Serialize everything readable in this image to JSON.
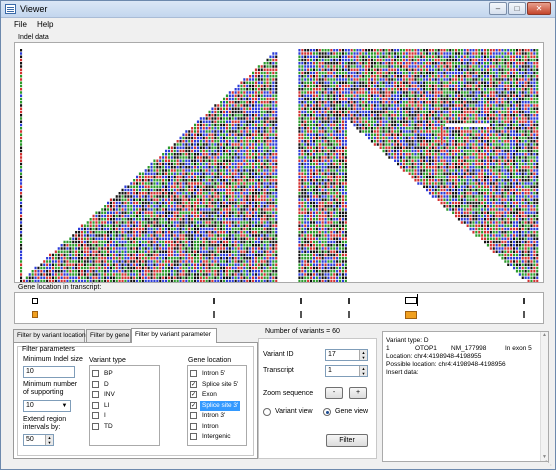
{
  "window": {
    "title": "Viewer",
    "minimize_icon": "minimize-icon",
    "maximize_icon": "maximize-icon",
    "close_icon": "close-icon"
  },
  "menu": [
    "File",
    "Help"
  ],
  "indel_section": {
    "label": "Indel data",
    "bases": "ACGT",
    "colors": {
      "A": "#2a9a2a",
      "C": "#2a3ad8",
      "G": "#111111",
      "T": "#d23030"
    }
  },
  "gene_location_section": {
    "label": "Gene location in transcript:"
  },
  "tabs": [
    "Filter by variant location",
    "Filter by gene",
    "Filter by variant parameter"
  ],
  "active_tab": 2,
  "filter_parameters": {
    "group_label": "Filter parameters",
    "min_indel_label": "Minimum Indel size",
    "min_indel_value": "10",
    "min_supporting_label_1": "Minimum number",
    "min_supporting_label_2": "of supporting",
    "min_supporting_value": "10",
    "extend_label_1": "Extend region",
    "extend_label_2": "intervals by:",
    "extend_value": "50"
  },
  "variant_type": {
    "label": "Variant type",
    "items": [
      {
        "label": "BP",
        "checked": false
      },
      {
        "label": "D",
        "checked": false
      },
      {
        "label": "INV",
        "checked": false
      },
      {
        "label": "LI",
        "checked": false
      },
      {
        "label": "I",
        "checked": false
      },
      {
        "label": "TD",
        "checked": false
      }
    ]
  },
  "gene_location": {
    "label": "Gene location",
    "items": [
      {
        "label": "Intron 5'",
        "checked": false,
        "selected": false
      },
      {
        "label": "Splice site 5'",
        "checked": true,
        "selected": false
      },
      {
        "label": "Exon",
        "checked": true,
        "selected": false
      },
      {
        "label": "Splice site 3'",
        "checked": true,
        "selected": true
      },
      {
        "label": "Intron 3'",
        "checked": false,
        "selected": false
      },
      {
        "label": "Intron",
        "checked": false,
        "selected": false
      },
      {
        "label": "Intergenic",
        "checked": false,
        "selected": false
      }
    ]
  },
  "controls": {
    "number_of_variants": "Number of variants = 60",
    "variant_id_label": "Variant ID",
    "variant_id_value": "17",
    "transcript_label": "Transcript",
    "transcript_value": "1",
    "zoom_label": "Zoom sequence",
    "zoom_out": "-",
    "zoom_in": "+",
    "variant_view_label": "Variant view",
    "gene_view_label": "Gene view",
    "view_selected": "gene",
    "filter_button": "Filter"
  },
  "info": {
    "line1": "Variant type: D",
    "line2_a": "1",
    "line2_b": "OTOP1",
    "line2_c": "NM_177998",
    "line2_d": "In exon 5",
    "line3": "Location: chr4:4198948-4198955",
    "line4": "Possible location: chr4:4198948-4198956",
    "line5": "Insert data:"
  },
  "colors": {
    "gene_bar": "#f0a020",
    "selection": "#3399ff"
  }
}
